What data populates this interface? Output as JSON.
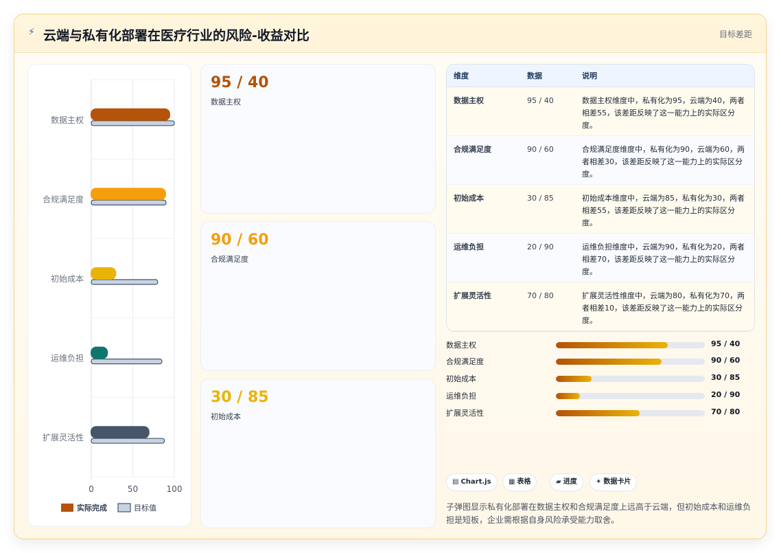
{
  "header": {
    "icon": "spark-icon",
    "title": "云端与私有化部署在医疗行业的风险-收益对比",
    "badge": "目标差距"
  },
  "chart_data": {
    "type": "bar",
    "orientation": "horizontal",
    "categories": [
      "数据主权",
      "合规满足度",
      "初始成本",
      "运维负担",
      "扩展灵活性"
    ],
    "series": [
      {
        "name": "实际完成",
        "values": [
          95,
          90,
          30,
          20,
          70
        ],
        "colors": [
          "#b45309",
          "#f59e0b",
          "#eab308",
          "#0f766e",
          "#475569"
        ]
      },
      {
        "name": "目标值",
        "values": [
          100,
          90,
          80,
          85,
          88
        ],
        "color": "#c7d3e3"
      }
    ],
    "xlim": [
      0,
      100
    ],
    "xticks": [
      "0",
      "50",
      "100"
    ],
    "grid": true,
    "legend": "bottom"
  },
  "kpis": [
    {
      "value": "95 / 40",
      "label": "数据主权",
      "color": "#b45309"
    },
    {
      "value": "90 / 60",
      "label": "合规满足度",
      "color": "#f59e0b"
    },
    {
      "value": "30 / 85",
      "label": "初始成本",
      "color": "#eab308"
    }
  ],
  "table": {
    "headers": [
      "维度",
      "数据",
      "说明"
    ],
    "rows": [
      {
        "dim": "数据主权",
        "num": "95 / 40",
        "desc": "数据主权维度中，私有化为95，云端为40，两者相差55，该差距反映了这一能力上的实际区分度。"
      },
      {
        "dim": "合规满足度",
        "num": "90 / 60",
        "desc": "合规满足度维度中，私有化为90，云端为60，两者相差30，该差距反映了这一能力上的实际区分度。"
      },
      {
        "dim": "初始成本",
        "num": "30 / 85",
        "desc": "初始成本维度中，云端为85，私有化为30，两者相差55，该差距反映了这一能力上的实际区分度。"
      },
      {
        "dim": "运维负担",
        "num": "20 / 90",
        "desc": "运维负担维度中，云端为90，私有化为20，两者相差70，该差距反映了这一能力上的实际区分度。"
      },
      {
        "dim": "扩展灵活性",
        "num": "70 / 80",
        "desc": "扩展灵活性维度中，云端为80，私有化为70，两者相差10，该差距反映了这一能力上的实际区分度。"
      }
    ]
  },
  "progress": [
    {
      "label": "数据主权",
      "value": "95 / 40",
      "pct": 0.75
    },
    {
      "label": "合规满足度",
      "value": "90 / 60",
      "pct": 0.71
    },
    {
      "label": "初始成本",
      "value": "30 / 85",
      "pct": 0.24
    },
    {
      "label": "运维负担",
      "value": "20 / 90",
      "pct": 0.16
    },
    {
      "label": "扩展灵活性",
      "value": "70 / 80",
      "pct": 0.56
    }
  ],
  "tags": [
    {
      "icon": "▤",
      "label": "Chart.js"
    },
    {
      "icon": "▦",
      "label": "表格"
    },
    {
      "icon": "▰",
      "label": "进度"
    },
    {
      "icon": "✦",
      "label": "数据卡片"
    }
  ],
  "summary": "子弹图显示私有化部署在数据主权和合规满足度上远高于云端，但初始成本和运维负担是短板，企业需根据自身风险承受能力取舍。"
}
